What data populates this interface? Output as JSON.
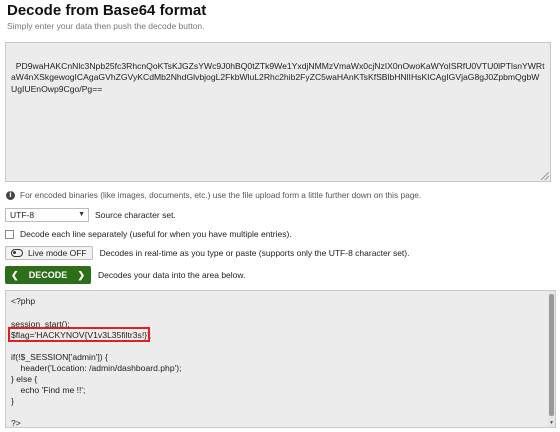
{
  "header": {
    "title": "Decode from Base64 format",
    "subtitle": "Simply enter your data then push the decode button."
  },
  "input": {
    "value": "PD9waHAKCnNlc3Npb25fc3RhcnQoKTsKJGZsYWc9J0hBQ0tZTk9We1YxdjNMMzVmaWx0cjNzIX0nOwoKaWYoISRfU0VTU0lPTlsnYWRtaW4nXSkgewogICAgaGVhZGVyKCdMb2NhdGlvbjogL2FkbWluL2Rhc2hib2FyZC5waHAnKTsKfSBlbHNlIHsKICAgIGVjaG8gJ0ZpbmQgbWUgIUEnOwp9Cgo/Pg=="
  },
  "info": {
    "icon": "info-icon",
    "text": "For encoded binaries (like images, documents, etc.) use the file upload form a little further down on this page."
  },
  "charset": {
    "selected": "UTF-8",
    "label": "Source character set."
  },
  "each_line": {
    "label": "Decode each line separately (useful for when you have multiple entries)."
  },
  "live_mode": {
    "button_label": "Live mode OFF",
    "description": "Decodes in real-time as you type or paste (supports only the UTF-8 character set)."
  },
  "decode": {
    "button_label": "DECODE",
    "description": "Decodes your data into the area below."
  },
  "output": {
    "lines": [
      "<?php",
      "",
      "session_start();",
      "$flag='HACKYNOV{V1v3L35filtr3s!}';",
      "",
      "if(!$_SESSION['admin']) {",
      "    header('Location: /admin/dashboard.php');",
      "} else {",
      "    echo 'Find me !!';",
      "}",
      "",
      "?>"
    ]
  },
  "colors": {
    "decode_button": "#2c6e19",
    "highlight_box": "#e02020"
  }
}
